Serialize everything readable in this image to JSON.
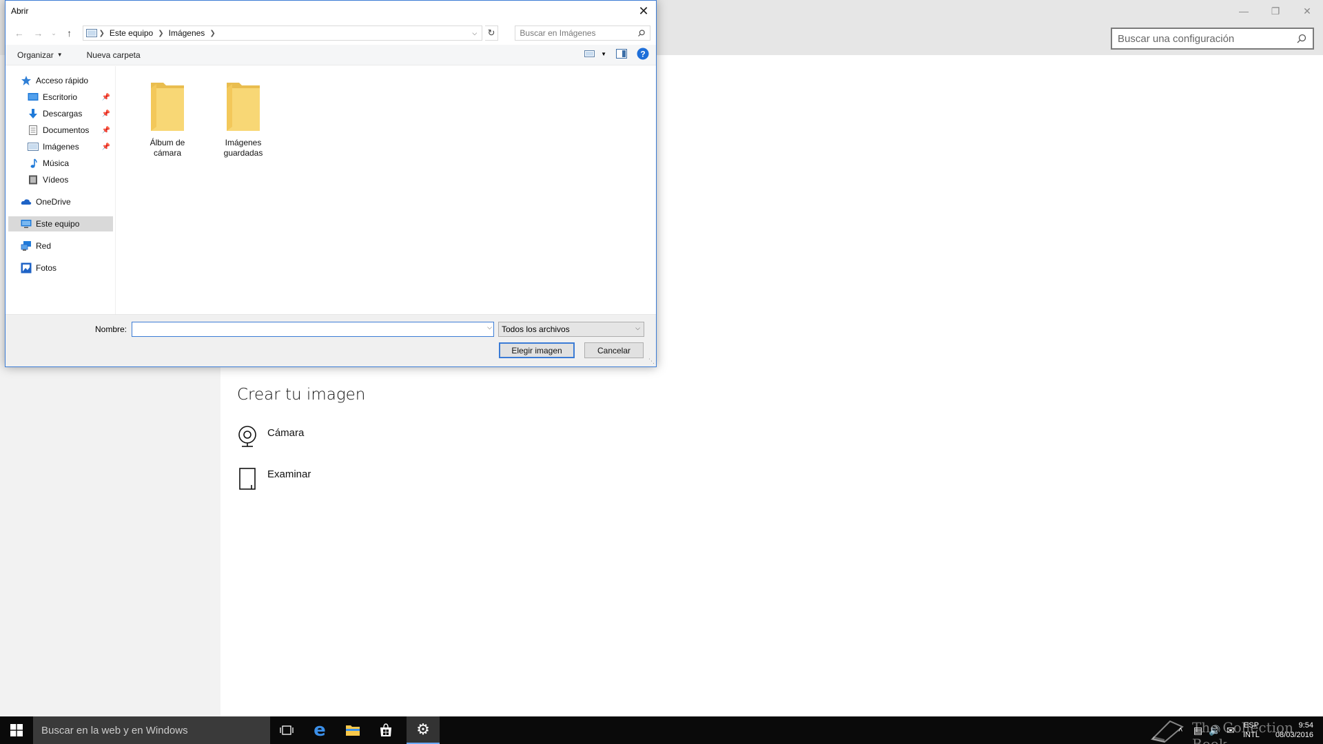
{
  "settings": {
    "search_placeholder": "Buscar una configuración",
    "section_title": "Crear tu imagen",
    "options": [
      {
        "label": "Cámara",
        "icon": "camera-icon"
      },
      {
        "label": "Examinar",
        "icon": "browse-icon"
      }
    ]
  },
  "dialog": {
    "title": "Abrir",
    "breadcrumb": [
      "Este equipo",
      "Imágenes"
    ],
    "search_placeholder": "Buscar en Imágenes",
    "commands": {
      "organize": "Organizar",
      "new_folder": "Nueva carpeta"
    },
    "nav": {
      "quick_access": "Acceso rápido",
      "desktop": "Escritorio",
      "downloads": "Descargas",
      "documents": "Documentos",
      "images": "Imágenes",
      "music": "Música",
      "videos": "Vídeos",
      "onedrive": "OneDrive",
      "this_pc": "Este equipo",
      "network": "Red",
      "photos": "Fotos"
    },
    "folders": [
      {
        "line1": "Álbum de",
        "line2": "cámara"
      },
      {
        "line1": "Imágenes",
        "line2": "guardadas"
      }
    ],
    "name_label": "Nombre:",
    "name_value": "",
    "file_type": "Todos los archivos",
    "buttons": {
      "open": "Elegir imagen",
      "cancel": "Cancelar"
    }
  },
  "taskbar": {
    "search_placeholder": "Buscar en la web y en Windows",
    "lang": "ESP",
    "layout": "INTL",
    "time": "9:54",
    "date": "08/03/2016",
    "watermark": "The Collection Book"
  },
  "colors": {
    "accent": "#3a7bd5",
    "folder": "#f8d775",
    "folder_dark": "#e9bd4f",
    "taskbar": "#0a0a0a"
  }
}
